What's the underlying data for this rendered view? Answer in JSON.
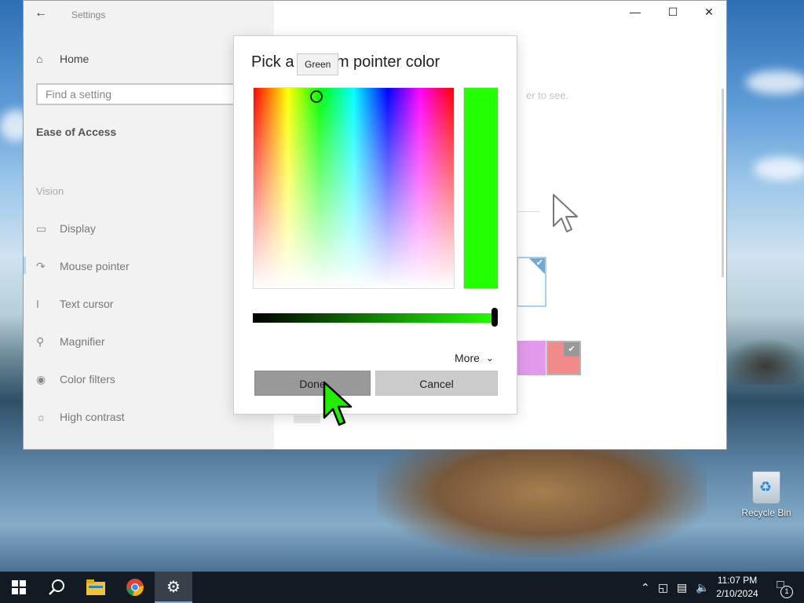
{
  "settings": {
    "title": "Settings",
    "nav_home": "Home",
    "search_placeholder": "Find a setting",
    "section": "Ease of Access",
    "group": "Vision",
    "nav_items": [
      {
        "label": "Display",
        "icon": "monitor-icon"
      },
      {
        "label": "Mouse pointer",
        "icon": "mouse-pointer-icon"
      },
      {
        "label": "Text cursor",
        "icon": "text-cursor-icon"
      },
      {
        "label": "Magnifier",
        "icon": "magnifier-icon"
      },
      {
        "label": "Color filters",
        "icon": "color-filters-icon"
      },
      {
        "label": "High contrast",
        "icon": "high-contrast-icon"
      }
    ],
    "hint_fragment": "er to see."
  },
  "dialog": {
    "title": "Pick a custom pointer color",
    "tooltip": "Green",
    "more_label": "More",
    "done_label": "Done",
    "cancel_label": "Cancel",
    "selected_color": "#22ff00",
    "value_level": 1.0
  },
  "desktop": {
    "recycle_bin_label": "Recycle Bin"
  },
  "taskbar": {
    "time": "11:07 PM",
    "date": "2/10/2024",
    "notification_count": "1",
    "pinned": [
      "start-icon",
      "search-icon",
      "file-explorer-icon",
      "chrome-icon",
      "settings-icon"
    ]
  }
}
